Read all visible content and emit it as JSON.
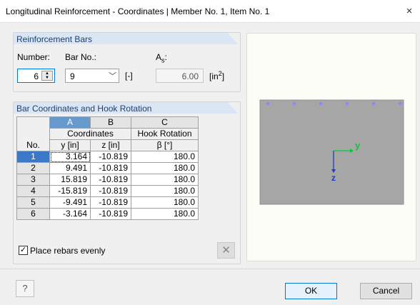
{
  "window": {
    "title": "Longitudinal Reinforcement - Coordinates | Member No. 1, Item No. 1",
    "close": "×"
  },
  "reinf": {
    "header": "Reinforcement Bars",
    "number_label": "Number:",
    "barno_label": "Bar No.:",
    "as_label": "A",
    "as_sub": "s",
    "as_colon": ":",
    "number_value": "6",
    "barno_value": "9",
    "barno_unit": "[-]",
    "as_value": "6.00",
    "as_unit_pre": "[in",
    "as_unit_sup": "2",
    "as_unit_post": "]"
  },
  "coords": {
    "header": "Bar Coordinates and Hook Rotation",
    "col_letters": [
      "A",
      "B",
      "C"
    ],
    "no_label": "No.",
    "group1": "Coordinates",
    "group2": "Hook Rotation",
    "sub": [
      "y [in]",
      "z [in]",
      "β [°]"
    ],
    "rows": [
      {
        "no": "1",
        "y": "3.164",
        "z": "-10.819",
        "b": "180.0"
      },
      {
        "no": "2",
        "y": "9.491",
        "z": "-10.819",
        "b": "180.0"
      },
      {
        "no": "3",
        "y": "15.819",
        "z": "-10.819",
        "b": "180.0"
      },
      {
        "no": "4",
        "y": "-15.819",
        "z": "-10.819",
        "b": "180.0"
      },
      {
        "no": "5",
        "y": "-9.491",
        "z": "-10.819",
        "b": "180.0"
      },
      {
        "no": "6",
        "y": "-3.164",
        "z": "-10.819",
        "b": "180.0"
      }
    ],
    "place_evenly": "Place rebars evenly",
    "place_evenly_checked": true
  },
  "preview": {
    "y_axis": "y",
    "z_axis": "z",
    "rebar_count": 6
  },
  "buttons": {
    "ok": "OK",
    "cancel": "Cancel"
  },
  "icons": {
    "help": "help-icon",
    "eraser": "eraser-icon"
  },
  "colors": {
    "header_bg": "#dbe6f4",
    "selected_row": "#3c78c8",
    "rebar": "#8888ff",
    "axis_y": "#00cc33",
    "axis_z": "#1e3cc8"
  }
}
